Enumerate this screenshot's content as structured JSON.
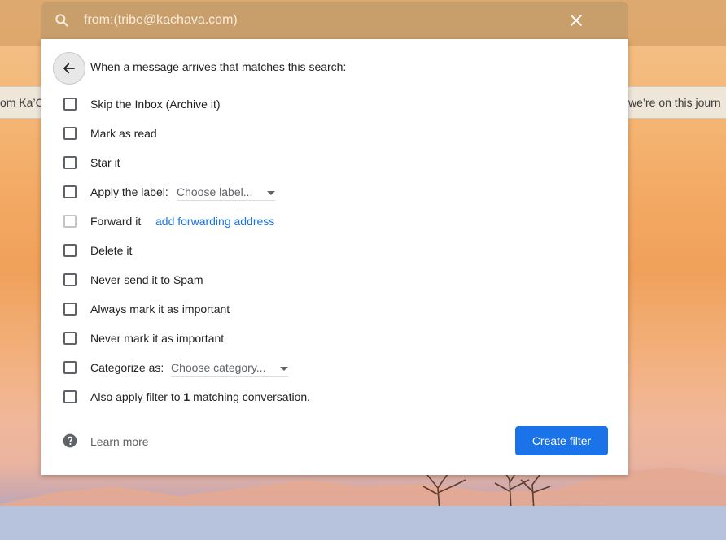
{
  "search": {
    "query": "from:(tribe@kachava.com)"
  },
  "background": {
    "left_snippet": "om Ka’C",
    "right_snippet": "w we’re on this journ"
  },
  "filter": {
    "heading": "When a message arrives that matches this search:",
    "options": [
      {
        "label": "Skip the Inbox (Archive it)",
        "checked": false
      },
      {
        "label": "Mark as read",
        "checked": false
      },
      {
        "label": "Star it",
        "checked": false
      },
      {
        "label": "Apply the label:",
        "checked": false,
        "select": "Choose label..."
      },
      {
        "label": "Forward it",
        "checked": false,
        "disabled": true,
        "link": "add forwarding address"
      },
      {
        "label": "Delete it",
        "checked": false
      },
      {
        "label": "Never send it to Spam",
        "checked": false
      },
      {
        "label": "Always mark it as important",
        "checked": false
      },
      {
        "label": "Never mark it as important",
        "checked": false
      },
      {
        "label": "Categorize as:",
        "checked": false,
        "select": "Choose category..."
      },
      {
        "label_prefix": "Also apply filter to ",
        "count": "1",
        "label_suffix": " matching conversation.",
        "checked": false
      }
    ],
    "learn_more": "Learn more",
    "create_button": "Create filter"
  },
  "colors": {
    "primary": "#1a73e8",
    "link": "#1a73e8",
    "search_bar": "#c89e6a"
  },
  "icons": [
    "search-icon",
    "close-icon",
    "arrow-back-icon",
    "help-icon",
    "chevron-down-icon"
  ]
}
